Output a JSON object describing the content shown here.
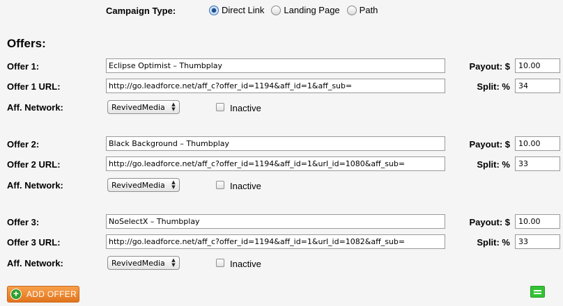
{
  "campaign_type": {
    "label": "Campaign Type:",
    "options": [
      {
        "label": "Direct Link",
        "checked": true
      },
      {
        "label": "Landing Page",
        "checked": false
      },
      {
        "label": "Path",
        "checked": false
      }
    ]
  },
  "offers_title": "Offers:",
  "offers": [
    {
      "name_label": "Offer 1:",
      "name": "Eclipse Optimist – Thumbplay",
      "url_label": "Offer 1 URL:",
      "url": "http://go.leadforce.net/aff_c?offer_id=1194&aff_id=1&aff_sub=",
      "network_label": "Aff. Network:",
      "network": "RevivedMedia",
      "inactive_label": "Inactive",
      "inactive": false,
      "payout_label": "Payout: $",
      "payout": "10.00",
      "split_label": "Split: %",
      "split": "34"
    },
    {
      "name_label": "Offer 2:",
      "name": "Black Background – Thumbplay",
      "url_label": "Offer 2 URL:",
      "url": "http://go.leadforce.net/aff_c?offer_id=1194&aff_id=1&url_id=1080&aff_sub=",
      "network_label": "Aff. Network:",
      "network": "RevivedMedia",
      "inactive_label": "Inactive",
      "inactive": false,
      "payout_label": "Payout: $",
      "payout": "10.00",
      "split_label": "Split: %",
      "split": "33"
    },
    {
      "name_label": "Offer 3:",
      "name": "NoSelectX – Thumbplay",
      "url_label": "Offer 3 URL:",
      "url": "http://go.leadforce.net/aff_c?offer_id=1194&aff_id=1&url_id=1082&aff_sub=",
      "network_label": "Aff. Network:",
      "network": "RevivedMedia",
      "inactive_label": "Inactive",
      "inactive": false,
      "payout_label": "Payout: $",
      "payout": "10.00",
      "split_label": "Split: %",
      "split": "33"
    }
  ],
  "add_offer_label": "ADD OFFER",
  "colors": {
    "add_offer_button": "#ef8a2e",
    "collapse_button": "#34c234"
  }
}
